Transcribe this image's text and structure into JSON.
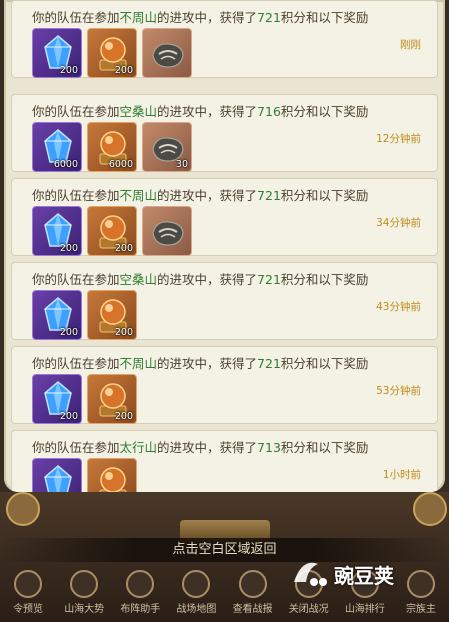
{
  "messages": [
    {
      "prefix": "你的队伍在参加",
      "mountain": "不周山",
      "mid": "的进攻中，获得了",
      "points": "721",
      "suffix": "积分和以下奖励",
      "time": "刚刚",
      "items": [
        {
          "type": "crystal",
          "qty": "200"
        },
        {
          "type": "orb",
          "qty": "200"
        },
        {
          "type": "stone",
          "qty": ""
        }
      ]
    },
    {
      "prefix": "你的队伍在参加",
      "mountain": "空桑山",
      "mid": "的进攻中，获得了",
      "points": "716",
      "suffix": "积分和以下奖励",
      "time": "12分钟前",
      "items": [
        {
          "type": "crystal",
          "qty": "6000"
        },
        {
          "type": "orb",
          "qty": "6000"
        },
        {
          "type": "stone",
          "qty": "30"
        }
      ]
    },
    {
      "prefix": "你的队伍在参加",
      "mountain": "不周山",
      "mid": "的进攻中，获得了",
      "points": "721",
      "suffix": "积分和以下奖励",
      "time": "34分钟前",
      "items": [
        {
          "type": "crystal",
          "qty": "200"
        },
        {
          "type": "orb",
          "qty": "200"
        },
        {
          "type": "stone",
          "qty": ""
        }
      ]
    },
    {
      "prefix": "你的队伍在参加",
      "mountain": "空桑山",
      "mid": "的进攻中，获得了",
      "points": "721",
      "suffix": "积分和以下奖励",
      "time": "43分钟前",
      "items": [
        {
          "type": "crystal",
          "qty": "200"
        },
        {
          "type": "orb",
          "qty": "200"
        }
      ]
    },
    {
      "prefix": "你的队伍在参加",
      "mountain": "不周山",
      "mid": "的进攻中，获得了",
      "points": "721",
      "suffix": "积分和以下奖励",
      "time": "53分钟前",
      "items": [
        {
          "type": "crystal",
          "qty": "200"
        },
        {
          "type": "orb",
          "qty": "200"
        }
      ]
    },
    {
      "prefix": "你的队伍在参加",
      "mountain": "太行山",
      "mid": "的进攻中，获得了",
      "points": "713",
      "suffix": "积分和以下奖励",
      "time": "1小时前",
      "items": [
        {
          "type": "crystal",
          "qty": ""
        },
        {
          "type": "orb",
          "qty": ""
        }
      ]
    }
  ],
  "hint": "点击空白区域返回",
  "nav": [
    {
      "label": "令预览",
      "icon": "ticket-icon"
    },
    {
      "label": "山海大势",
      "icon": "mountain-icon"
    },
    {
      "label": "布阵助手",
      "icon": "formation-icon"
    },
    {
      "label": "战场地图",
      "icon": "map-icon"
    },
    {
      "label": "查看战报",
      "icon": "report-icon"
    },
    {
      "label": "关闭战况",
      "icon": "close-battle-icon"
    },
    {
      "label": "山海排行",
      "icon": "ranking-icon"
    },
    {
      "label": "宗族主",
      "icon": "clan-icon"
    }
  ],
  "watermark": "豌豆荚",
  "colors": {
    "highlight": "#2f7d32",
    "time": "#c08a1a",
    "text": "#4a3f2e",
    "panel": "#e9e5d2"
  }
}
